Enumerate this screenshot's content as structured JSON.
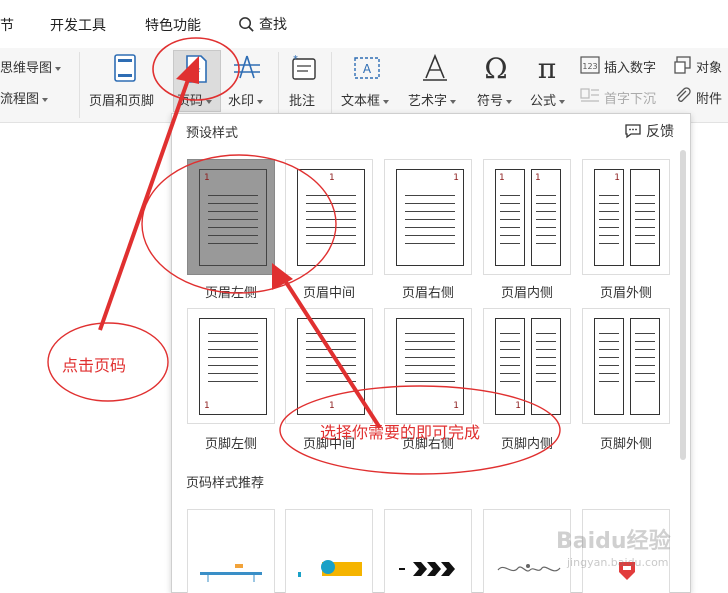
{
  "tabs": {
    "section": "节",
    "developer": "开发工具",
    "special": "特色功能",
    "search": "查找"
  },
  "ribbon": {
    "mindmap": "思维导图",
    "flowchart": "流程图",
    "header_footer": "页眉和页脚",
    "page_number": "页码",
    "watermark": "水印",
    "comment": "批注",
    "textbox": "文本框",
    "wordart": "艺术字",
    "symbol": "符号",
    "formula": "公式",
    "insert_number": "插入数字",
    "object": "对象",
    "drop_cap": "首字下沉",
    "attachment": "附件"
  },
  "popup": {
    "title": "预设样式",
    "feedback": "反馈",
    "page_number_digit": "1",
    "header_styles": [
      "页眉左侧",
      "页眉中间",
      "页眉右侧",
      "页眉内侧",
      "页眉外侧"
    ],
    "footer_styles": [
      "页脚左侧",
      "页脚中间",
      "页脚右侧",
      "页脚内侧",
      "页脚外侧"
    ],
    "recommend_title": "页码样式推荐"
  },
  "annotations": {
    "click_page_number": "点击页码",
    "select_to_finish": "选择你需要的即可完成"
  },
  "watermark": {
    "brand": "Baidu经验",
    "url": "jingyan.baidu.com"
  },
  "colors": {
    "annotation": "#e03030",
    "selected_tile": "#999999",
    "page_number": "#8b1a1a"
  }
}
